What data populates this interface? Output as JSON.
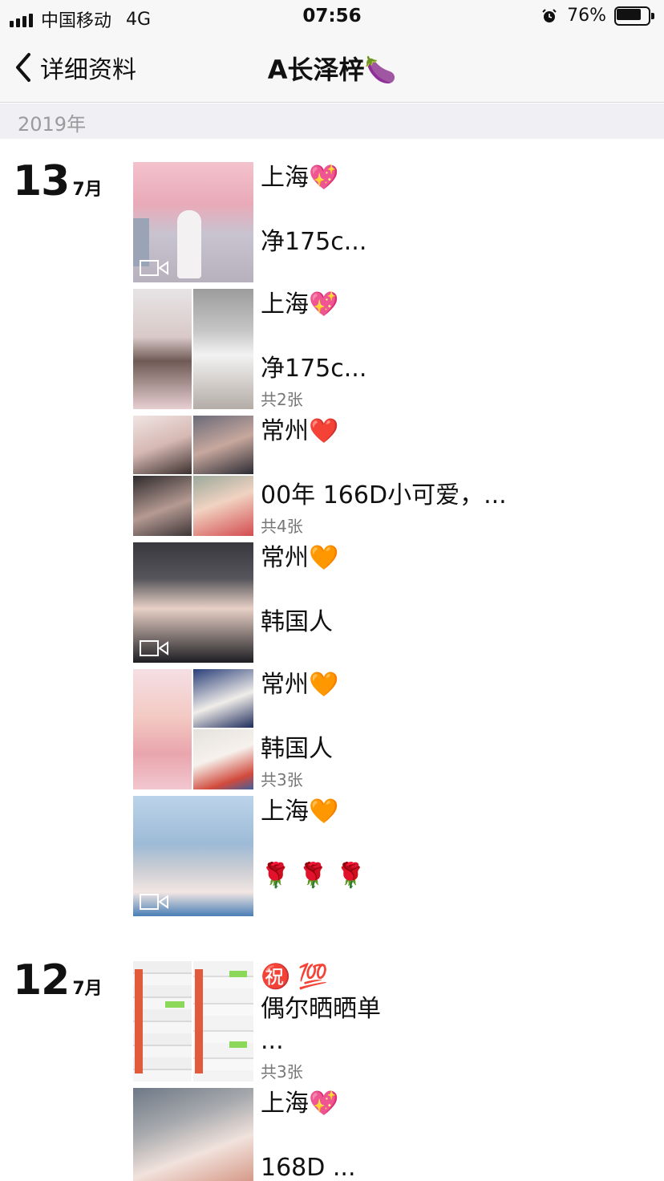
{
  "status_bar": {
    "carrier": "中国移动",
    "network": "4G",
    "time": "07:56",
    "battery": "76%",
    "battery_level": 0.76
  },
  "nav": {
    "back_label": "详细资料",
    "title": "A长泽梓🍆"
  },
  "year_label": "2019年",
  "days": [
    {
      "day": "13",
      "month": "7月",
      "posts": [
        {
          "line1": "上海💖",
          "line2": "净175c...",
          "count": "",
          "video": true
        },
        {
          "line1": "上海💖",
          "line2": "净175c...",
          "count": "共2张",
          "video": false
        },
        {
          "line1": "常州❤️",
          "line2": "00年 166D小可爱，...",
          "count": "共4张",
          "video": false
        },
        {
          "line1": "常州🧡",
          "line2": "韩国人",
          "count": "",
          "video": true
        },
        {
          "line1": "常州🧡",
          "line2": "韩国人",
          "count": "共3张",
          "video": false
        },
        {
          "line1": "上海🧡",
          "line2": "🌹 🌹 🌹",
          "count": "",
          "video": true
        }
      ]
    },
    {
      "day": "12",
      "month": "7月",
      "posts": [
        {
          "line1": "㊗️ 💯",
          "line1b": "偶尔晒晒单",
          "line2": "...",
          "count": "共3张",
          "video": false
        },
        {
          "line1": "上海💖",
          "line2": " 168D ...",
          "count": "",
          "video": false
        }
      ]
    }
  ]
}
